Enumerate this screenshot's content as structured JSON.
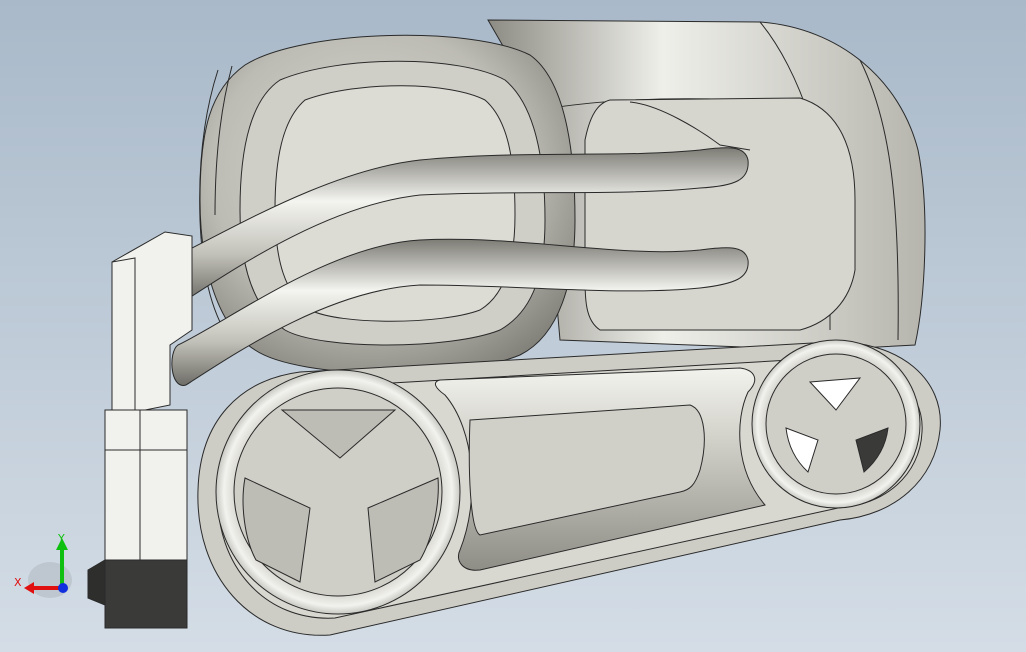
{
  "viewport": {
    "background_top": "#a9b9c9",
    "background_bottom": "#d4dde6"
  },
  "model": {
    "body_color": "#c9c8c0",
    "edge_color": "#2a2a2a",
    "dark_part_color": "#3a3b39"
  },
  "triad": {
    "x_label": "X",
    "y_label": "Y",
    "x_color": "#e01010",
    "y_color": "#10c010",
    "z_color": "#1030e0"
  }
}
